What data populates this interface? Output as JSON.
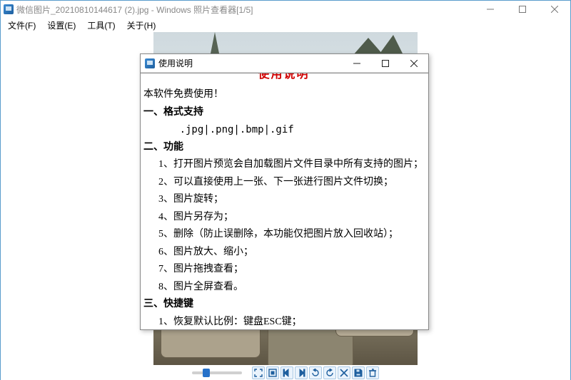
{
  "window": {
    "title": "微信图片_20210810144617 (2).jpg - Windows 照片查看器[1/5]"
  },
  "menu": {
    "file": "文件(F)",
    "settings": "设置(E)",
    "tools": "工具(T)",
    "about": "关于(H)"
  },
  "toolbar_icons": {
    "fit": "fit-screen",
    "actual": "actual-size",
    "prev": "previous",
    "next": "next",
    "rotl": "rotate-left",
    "rotr": "rotate-right",
    "crop": "crop",
    "save": "save",
    "delete": "delete"
  },
  "dialog": {
    "title": "使用说明",
    "heading": "使用说明",
    "intro": "本软件免费使用！",
    "sec1_title": "一、格式支持",
    "sec1_body": "      .jpg|.png|.bmp|.gif",
    "sec2_title": "二、功能",
    "f1": "      1、打开图片预览会自加载图片文件目录中所有支持的图片；",
    "f2": "      2、可以直接使用上一张、下一张进行图片文件切换；",
    "f3": "      3、图片旋转；",
    "f4": "      4、图片另存为；",
    "f5": "      5、删除（防止误删除，本功能仅把图片放入回收站）；",
    "f6": "      6、图片放大、缩小；",
    "f7": "      7、图片拖拽查看；",
    "f8": "      8、图片全屏查看。",
    "sec3_title": "三、快捷键",
    "k1": "      1、恢复默认比例：键盘ESC键；"
  }
}
